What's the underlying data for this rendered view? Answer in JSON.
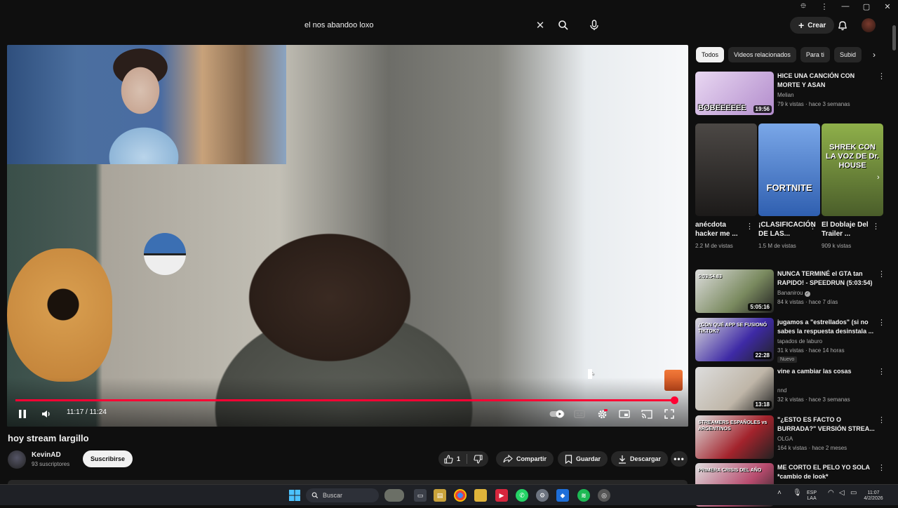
{
  "window": {
    "controls": [
      "⯐",
      "⋮",
      "—",
      "▢",
      "✕"
    ]
  },
  "header": {
    "search_value": "el nos abandoo loxo",
    "create_label": "Crear"
  },
  "player": {
    "time": "11:17 / 11:24",
    "progress_fraction": 0.9926
  },
  "video": {
    "title": "hoy stream largillo",
    "channel": "KevinAD",
    "subscribers": "93 suscriptores",
    "subscribe_label": "Suscribirse",
    "like_count": "1",
    "share_label": "Compartir",
    "save_label": "Guardar",
    "download_label": "Descargar"
  },
  "chips": [
    "Todos",
    "Videos relacionados",
    "Para ti",
    "Subid"
  ],
  "recs_top": [
    {
      "title": "HICE UNA CANCIÓN CON MORTE Y ASAN",
      "channel": "Melian",
      "meta": "79 k vistas · hace 3 semanas",
      "duration": "19:56",
      "thumb_text": "BOBEEEEEE",
      "bg": "#c9a7d9"
    }
  ],
  "shorts": [
    {
      "title": "anécdota hacker me ...",
      "views": "2.2 M de vistas",
      "bg": "#2d2a29",
      "label": ""
    },
    {
      "title": "¡CLASIFICACIÓN DE LAS...",
      "views": "1.5 M de vistas",
      "bg": "#3f74c9",
      "label": "FORTNITE"
    },
    {
      "title": "El Doblaje Del Trailer ...",
      "views": "909 k vistas",
      "bg": "#6a8a3f",
      "label": "SHREK CON LA VOZ DE Dr. HOUSE"
    }
  ],
  "recs": [
    {
      "title": "NUNCA TERMINÉ el GTA tan RAPIDO! - SPEEDRUN (5:03:54)",
      "channel": "Bananirou",
      "verified": true,
      "meta": "84 k vistas · hace 7 días",
      "duration": "5:05:16",
      "thumb_text": "5:03:54.83",
      "bg": "#7a8a5f",
      "is_new": false
    },
    {
      "title": "jugamos a \"estrellados\" (si no sabes la respuesta desinstala ...",
      "channel": "tapados de laburo",
      "verified": false,
      "meta": "31 k vistas · hace 14 horas",
      "duration": "22:28",
      "thumb_text": "¿CON QUÉ APP SE FUSIONÓ TIKTOK?",
      "bg": "#3e2aa6",
      "is_new": true,
      "new_label": "Nuevo"
    },
    {
      "title": "vine a cambiar las cosas",
      "channel": "nnd",
      "verified": false,
      "meta": "32 k vistas · hace 3 semanas",
      "duration": "13:18",
      "thumb_text": "",
      "bg": "#bfb6a8",
      "is_new": false
    },
    {
      "title": "\"¿ESTO ES FACTO O BURRADA?\" VERSIÓN STREA...",
      "channel": "OLGA",
      "verified": false,
      "meta": "164 k vistas · hace 2 meses",
      "duration": "",
      "thumb_text": "STREAMERS ESPAÑOLES vs ARGENTINOS",
      "bg": "#a3232c",
      "is_new": false
    },
    {
      "title": "ME CORTO EL PELO YO SOLA *cambio de look*",
      "channel": "",
      "verified": false,
      "meta": "",
      "duration": "",
      "thumb_text": "PRIMERA CRISIS DEL AÑO",
      "bg": "#b84b6e",
      "is_new": false
    }
  ],
  "taskbar": {
    "search_label": "Buscar",
    "lang_top": "ESP",
    "lang_bottom": "LAA",
    "time": "11:07",
    "date": "4/2/2026"
  }
}
